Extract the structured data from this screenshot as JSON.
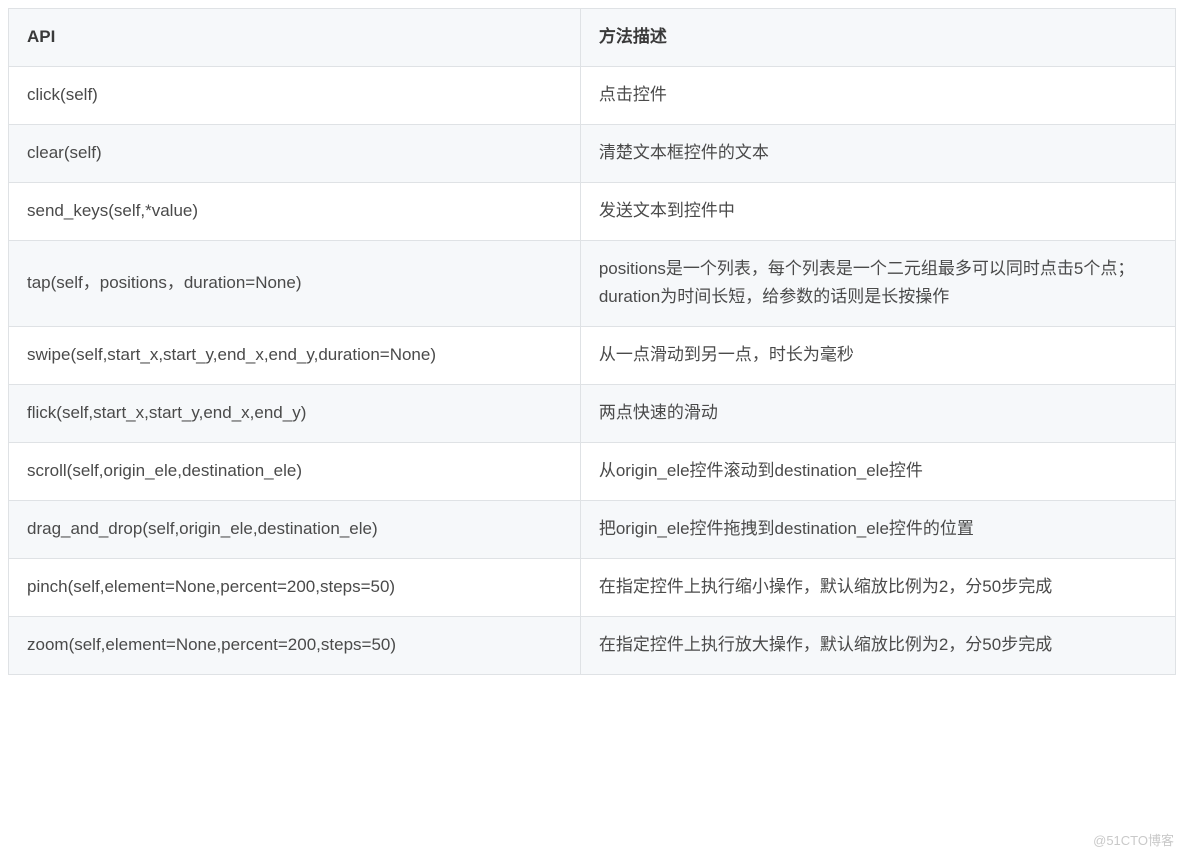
{
  "table": {
    "headers": {
      "api": "API",
      "desc": "方法描述"
    },
    "rows": [
      {
        "api": "click(self)",
        "desc": "点击控件"
      },
      {
        "api": "clear(self)",
        "desc": "清楚文本框控件的文本"
      },
      {
        "api": "send_keys(self,*value)",
        "desc": "发送文本到控件中"
      },
      {
        "api": "tap(self，positions，duration=None)",
        "desc": "positions是一个列表，每个列表是一个二元组最多可以同时点击5个点；duration为时间长短，给参数的话则是长按操作"
      },
      {
        "api": "swipe(self,start_x,start_y,end_x,end_y,duration=None)",
        "desc": "从一点滑动到另一点，时长为毫秒"
      },
      {
        "api": "flick(self,start_x,start_y,end_x,end_y)",
        "desc": "两点快速的滑动"
      },
      {
        "api": "scroll(self,origin_ele,destination_ele)",
        "desc": "从origin_ele控件滚动到destination_ele控件"
      },
      {
        "api": "drag_and_drop(self,origin_ele,destination_ele)",
        "desc": "把origin_ele控件拖拽到destination_ele控件的位置"
      },
      {
        "api": "pinch(self,element=None,percent=200,steps=50)",
        "desc": "在指定控件上执行缩小操作，默认缩放比例为2，分50步完成"
      },
      {
        "api": "zoom(self,element=None,percent=200,steps=50)",
        "desc": "在指定控件上执行放大操作，默认缩放比例为2，分50步完成"
      }
    ]
  },
  "watermark": "@51CTO博客"
}
